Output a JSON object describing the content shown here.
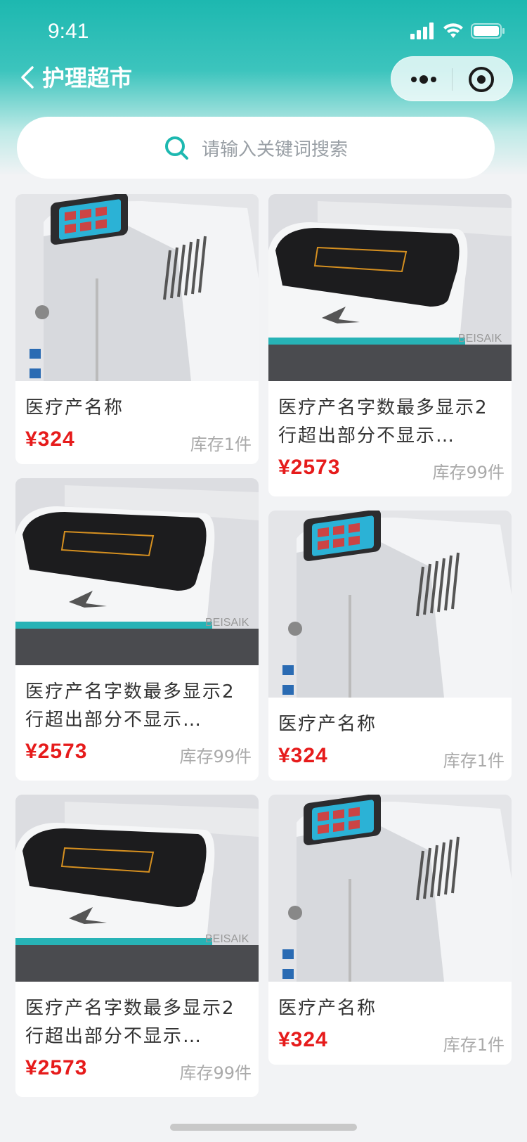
{
  "status": {
    "time": "9:41"
  },
  "nav": {
    "title": "护理超市"
  },
  "search": {
    "placeholder": "请输入关键词搜索"
  },
  "colors": {
    "primary": "#1db8b0",
    "price": "#e61b1b"
  },
  "products": [
    {
      "name": "医疗产名称",
      "price": "¥324",
      "stock": "库存1件",
      "image": "touchscreen-machine"
    },
    {
      "name": "医疗产名字数最多显示2行超出部分不显示…",
      "price": "¥2573",
      "stock": "库存99件",
      "image": "beisaik-machine"
    },
    {
      "name": "医疗产名字数最多显示2行超出部分不显示…",
      "price": "¥2573",
      "stock": "库存99件",
      "image": "beisaik-machine"
    },
    {
      "name": "医疗产名称",
      "price": "¥324",
      "stock": "库存1件",
      "image": "touchscreen-machine"
    },
    {
      "name": "医疗产名字数最多显示2行超出部分不显示…",
      "price": "¥2573",
      "stock": "库存99件",
      "image": "beisaik-machine"
    },
    {
      "name": "医疗产名称",
      "price": "¥324",
      "stock": "库存1件",
      "image": "touchscreen-machine"
    }
  ],
  "brand_text": "BEISAIK"
}
